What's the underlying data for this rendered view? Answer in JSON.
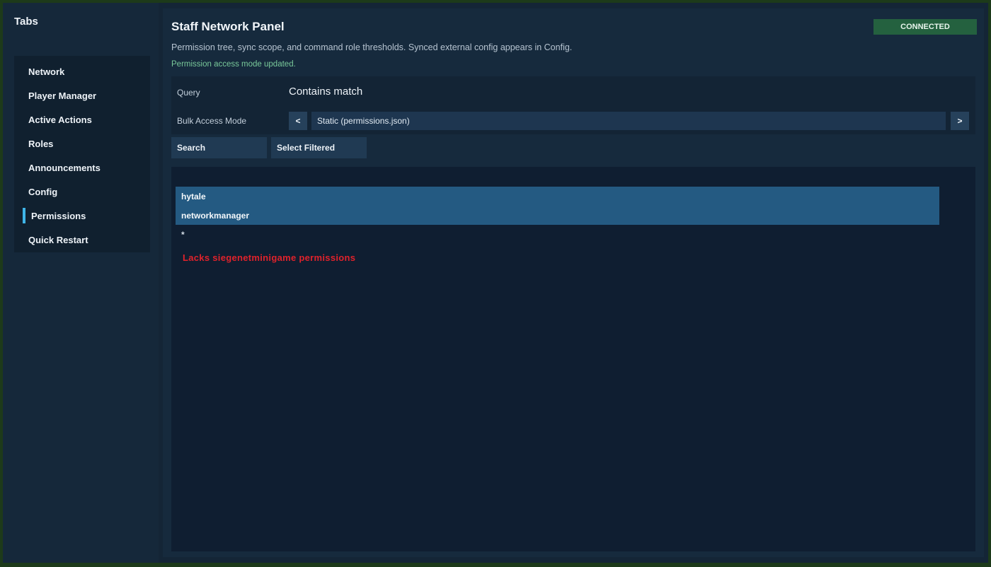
{
  "sidebar": {
    "title": "Tabs",
    "items": [
      {
        "label": "Network"
      },
      {
        "label": "Player Manager"
      },
      {
        "label": "Active Actions"
      },
      {
        "label": "Roles"
      },
      {
        "label": "Announcements"
      },
      {
        "label": "Config"
      },
      {
        "label": "Permissions",
        "active": true
      },
      {
        "label": "Quick Restart"
      }
    ]
  },
  "header": {
    "title": "Staff Network Panel",
    "status": "CONNECTED",
    "subtitle": "Permission tree, sync scope, and command role thresholds. Synced external config appears in Config.",
    "message": "Permission access mode updated."
  },
  "controls": {
    "query_label": "Query",
    "query_value": "Contains match",
    "mode_label": "Bulk Access Mode",
    "prev_label": "<",
    "mode_value": "Static (permissions.json)",
    "next_label": ">"
  },
  "actions": {
    "search_label": "Search",
    "select_filtered_label": "Select Filtered"
  },
  "list": {
    "rows": [
      {
        "label": "hytale",
        "selected": true
      },
      {
        "label": "networkmanager",
        "selected": true
      },
      {
        "label": "*",
        "selected": false
      }
    ],
    "warning": "Lacks siegenetminigame permissions"
  },
  "colors": {
    "accent": "#3fb5e8",
    "status_ok": "#24613f",
    "selected_row": "#245a82",
    "warning": "#e0222b",
    "message": "#79c99a"
  }
}
